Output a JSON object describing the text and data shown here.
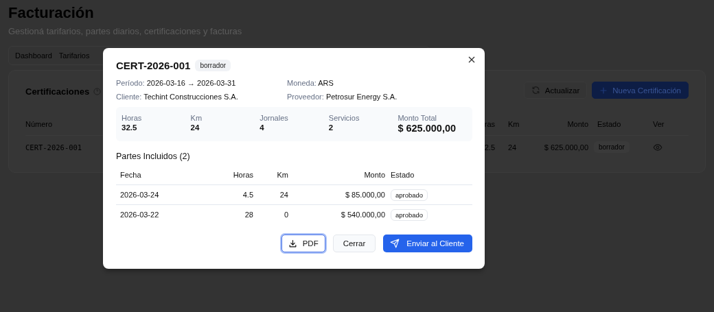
{
  "page": {
    "title": "Facturación",
    "subtitle": "Gestioná tarifarios, partes diarios, certificaciones y facturas",
    "tabs": [
      {
        "label": "Dashboard"
      },
      {
        "label": "Tarifarios"
      }
    ]
  },
  "card": {
    "title": "Certificaciones",
    "buttons": [
      {
        "label": "Actualizar",
        "kind": "refresh"
      },
      {
        "label": "Nueva Certificación",
        "kind": "new"
      }
    ],
    "table": {
      "columns": [
        "Número",
        "ras",
        "Km",
        "Monto",
        "Estado",
        "Ver"
      ],
      "rows": [
        {
          "cells": [
            "CERT-2026-001",
            "2.5",
            "24",
            "$ 625.000,00"
          ],
          "status": "borrador"
        }
      ]
    }
  },
  "modal": {
    "title": "CERT-2026-001",
    "status": "borrador",
    "fields": [
      {
        "label": "Período:",
        "value": "2026-03-16 → 2026-03-31"
      },
      {
        "label": "Moneda:",
        "value": "ARS"
      },
      {
        "label": "Cliente:",
        "value": "Techint Construcciones S.A."
      },
      {
        "label": "Proveedor:",
        "value": "Petrosur Energy S.A."
      }
    ],
    "summary": [
      {
        "label": "Horas",
        "value": "32.5",
        "kind": "count"
      },
      {
        "label": "Km",
        "value": "24",
        "kind": "count"
      },
      {
        "label": "Jornales",
        "value": "4",
        "kind": "count"
      },
      {
        "label": "Servicios",
        "value": "2",
        "kind": "count"
      },
      {
        "label": "Monto Total",
        "value": "$ 625.000,00",
        "kind": "total"
      }
    ],
    "section_title": "Partes Incluidos (2)",
    "table": {
      "columns": [
        "Fecha",
        "Horas",
        "Km",
        "Monto",
        "Estado"
      ],
      "rows": [
        {
          "cells": [
            "2026-03-24",
            "4.5",
            "24",
            "$ 85.000,00"
          ],
          "status": "aprobado"
        },
        {
          "cells": [
            "2026-03-22",
            "28",
            "0",
            "$ 540.000,00"
          ],
          "status": "aprobado"
        }
      ]
    },
    "buttons": [
      {
        "label": "PDF",
        "kind": "download"
      },
      {
        "label": "Cerrar",
        "kind": "secondary"
      },
      {
        "label": "Enviar al Cliente",
        "kind": "primary"
      }
    ]
  }
}
